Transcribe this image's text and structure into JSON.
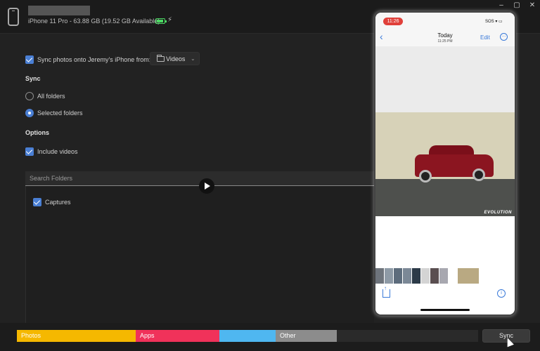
{
  "header": {
    "device_info": "iPhone 11 Pro - 63.88 GB (19.52 GB Available)",
    "window_controls": [
      "–",
      "▢",
      "✕"
    ]
  },
  "sync_photos": {
    "label": "Sync photos onto Jeremy's iPhone from:",
    "checked": true,
    "source": "Videos"
  },
  "sync_section": {
    "title": "Sync",
    "options": [
      {
        "label": "All folders",
        "selected": false
      },
      {
        "label": "Selected folders",
        "selected": true
      }
    ]
  },
  "options_section": {
    "title": "Options",
    "include_videos": {
      "label": "Include videos",
      "checked": true
    }
  },
  "search": {
    "placeholder": "Search Folders"
  },
  "folders": [
    {
      "label": "Captures",
      "checked": true
    }
  ],
  "storage": {
    "segments": [
      {
        "label": "Photos",
        "color": "#f5b800"
      },
      {
        "label": "Apps",
        "color": "#f0325a"
      },
      {
        "label": "",
        "color": "#4fb7f0"
      },
      {
        "label": "Other",
        "color": "#8c8c8c"
      }
    ]
  },
  "sync_button": {
    "label": "Sync"
  },
  "phone": {
    "time": "11:26",
    "status_right": "SOS ▾ ▭",
    "nav_title": "Today",
    "nav_subtitle": "11:25 PM",
    "edit_label": "Edit",
    "photo_watermark": "EVOLUTION"
  }
}
